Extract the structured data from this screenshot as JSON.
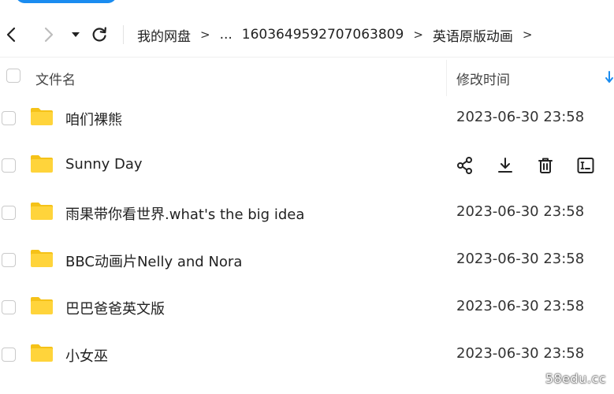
{
  "breadcrumb": {
    "items": [
      "我的网盘",
      "...",
      "1603649592707063809",
      "英语原版动画"
    ],
    "separator": ">"
  },
  "table": {
    "header": {
      "name_label": "文件名",
      "date_label": "修改时间"
    },
    "rows": [
      {
        "name": "咱们裸熊",
        "date": "2023-06-30 23:58",
        "hovered": false
      },
      {
        "name": "Sunny Day",
        "date": "",
        "hovered": true
      },
      {
        "name": "雨果带你看世界.what's the big idea",
        "date": "2023-06-30 23:58",
        "hovered": false
      },
      {
        "name": "BBC动画片Nelly and Nora",
        "date": "2023-06-30 23:58",
        "hovered": false
      },
      {
        "name": "巴巴爸爸英文版",
        "date": "2023-06-30 23:58",
        "hovered": false
      },
      {
        "name": "小女巫",
        "date": "2023-06-30 23:58",
        "hovered": false
      }
    ],
    "row_actions": [
      "share-icon",
      "download-icon",
      "delete-icon",
      "rename-icon"
    ]
  },
  "watermark": "58edu.cc",
  "colors": {
    "accent": "#1a8cf0",
    "folder": "#ffd43b",
    "folder_tab": "#f5c218"
  }
}
